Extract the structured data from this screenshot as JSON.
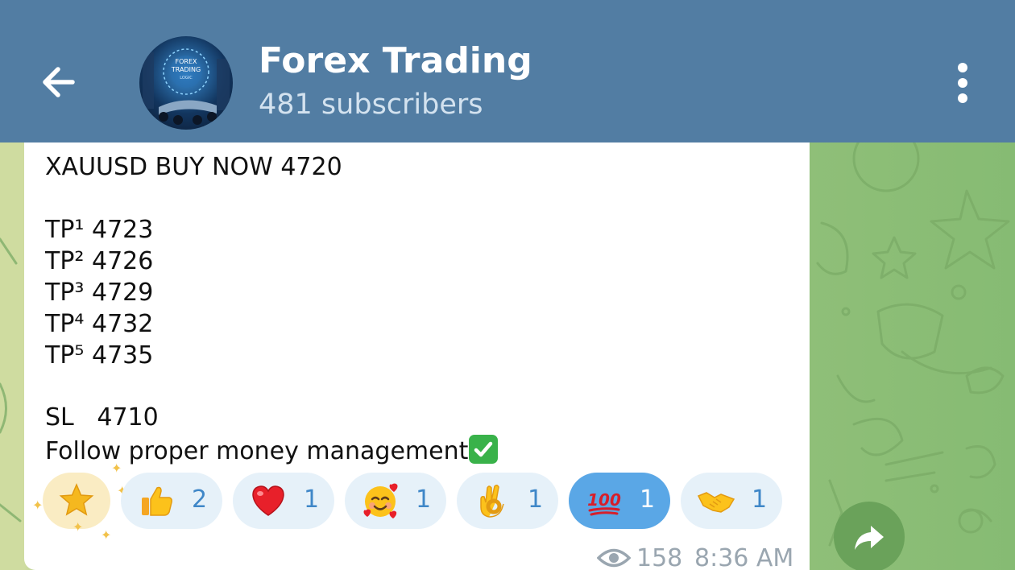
{
  "header": {
    "title": "Forex Trading",
    "subtitle": "481 subscribers",
    "avatar_text": "FOREX TRADING LOGIC",
    "back_icon": "arrow-left-icon",
    "menu_icon": "more-vertical-icon"
  },
  "message": {
    "lines": [
      "XAUUSD BUY NOW 4720",
      "TP¹ 4723",
      "TP² 4726",
      "TP³ 4729",
      "TP⁴ 4732",
      "TP⁵ 4735",
      "SL   4710",
      "Follow proper money management"
    ],
    "trailing_emoji": "check-mark-button-icon",
    "views": "158",
    "time": "8:36 AM"
  },
  "reactions": [
    {
      "emoji": "star-icon",
      "count": ""
    },
    {
      "emoji": "thumbs-up-icon",
      "count": "2"
    },
    {
      "emoji": "red-heart-icon",
      "count": "1"
    },
    {
      "emoji": "smiling-face-with-hearts-icon",
      "count": "1"
    },
    {
      "emoji": "ok-hand-icon",
      "count": "1"
    },
    {
      "emoji": "hundred-points-icon",
      "count": "1",
      "selected": true
    },
    {
      "emoji": "handshake-icon",
      "count": "1"
    }
  ],
  "colors": {
    "header_bg": "#527da3",
    "chat_bg": "#8fbf78",
    "reaction_bg": "#e6f1f9",
    "reaction_selected_bg": "#5aa7e6",
    "reaction_count": "#3f87c8"
  }
}
